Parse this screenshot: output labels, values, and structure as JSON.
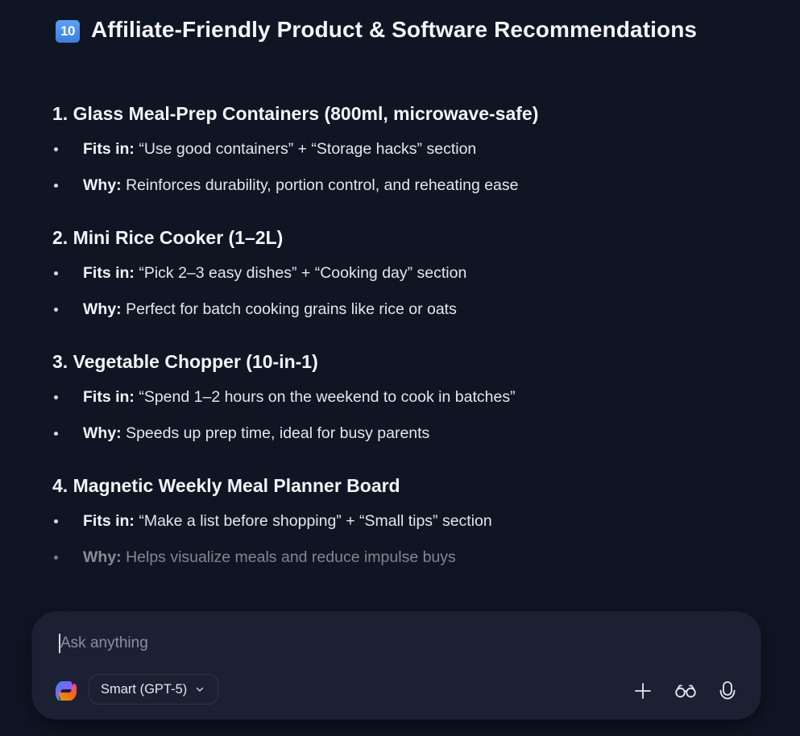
{
  "header": {
    "emoji": "10",
    "title": "Affiliate-Friendly Product & Software Recommendations"
  },
  "sections": [
    {
      "title": "1. Glass Meal-Prep Containers (800ml, microwave-safe)",
      "fits_label": "Fits in:",
      "fits_text": " “Use good containers” + “Storage hacks” section",
      "why_label": "Why:",
      "why_text": " Reinforces durability, portion control, and reheating ease"
    },
    {
      "title": "2. Mini Rice Cooker (1–2L)",
      "fits_label": "Fits in:",
      "fits_text": " “Pick 2–3 easy dishes” + “Cooking day” section",
      "why_label": "Why:",
      "why_text": " Perfect for batch cooking grains like rice or oats"
    },
    {
      "title": "3. Vegetable Chopper (10-in-1)",
      "fits_label": "Fits in:",
      "fits_text": " “Spend 1–2 hours on the weekend to cook in batches”",
      "why_label": "Why:",
      "why_text": " Speeds up prep time, ideal for busy parents"
    },
    {
      "title": "4. Magnetic Weekly Meal Planner Board",
      "fits_label": "Fits in:",
      "fits_text": " “Make a list before shopping” + “Small tips” section",
      "why_label": "Why:",
      "why_text": " Helps visualize meals and reduce impulse buys"
    }
  ],
  "composer": {
    "placeholder": "Ask anything",
    "model_label": "Smart (GPT-5)",
    "icons": {
      "logo": "copilot-logo",
      "model_chevron": "chevron-down-icon",
      "add": "plus-icon",
      "glasses": "glasses-icon",
      "mic": "microphone-icon"
    }
  },
  "colors": {
    "background": "#101524",
    "composer_bg": "#1b2133",
    "text": "#e6e8ee",
    "placeholder": "#8a90a0"
  }
}
